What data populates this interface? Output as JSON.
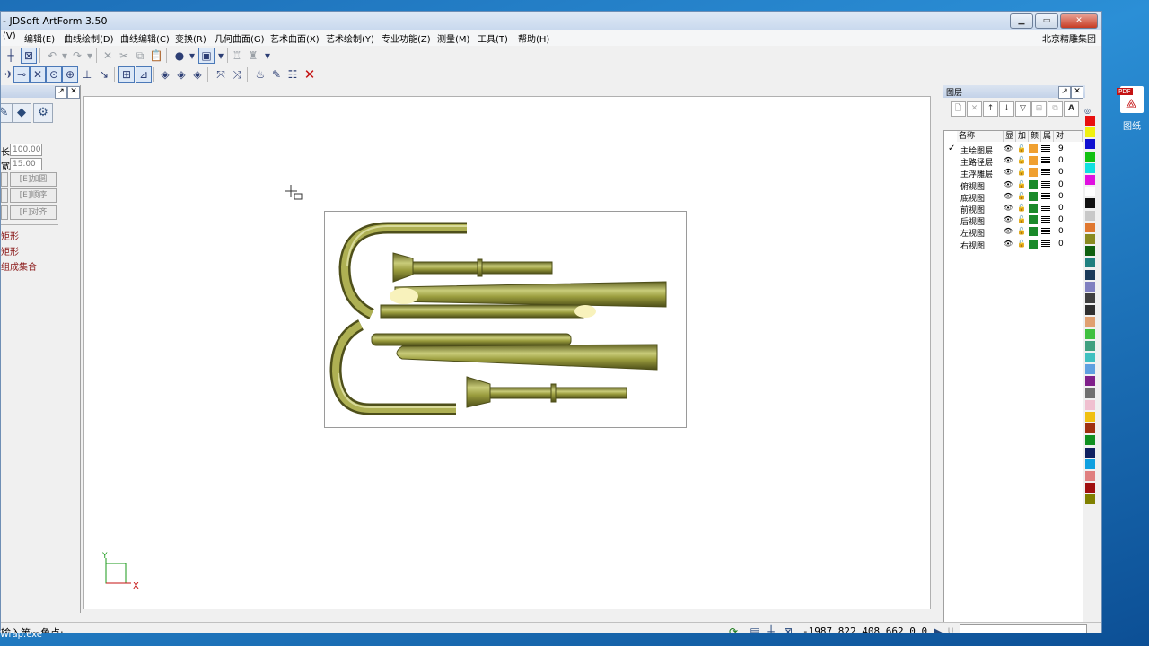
{
  "window": {
    "title": "- JDSoft ArtForm 3.50",
    "company": "北京精雕集团"
  },
  "menu": [
    "(V)",
    "编辑(E)",
    "曲线绘制(D)",
    "曲线编辑(C)",
    "变换(R)",
    "几何曲面(G)",
    "艺术曲面(X)",
    "艺术绘制(Y)",
    "专业功能(Z)",
    "测量(M)",
    "工具(T)",
    "帮助(H)"
  ],
  "left_panel": {
    "field1_label": "长:",
    "field1_value": "100.00",
    "field2_label": "宽:",
    "field2_value": "15.00",
    "btn1": "[E]加圆",
    "btn2": "[E]顺序",
    "btn3": "[E]对齐",
    "items": [
      "矩形",
      "矩形",
      "组成集合"
    ]
  },
  "layers": {
    "title": "图层",
    "headers": [
      "名称",
      "显",
      "加",
      "颜",
      "属",
      "对"
    ],
    "rows": [
      {
        "name": "主绘图层",
        "color": "#f0a030",
        "count": "9",
        "current": true
      },
      {
        "name": "主路径层",
        "color": "#f0a030",
        "count": "0",
        "current": false
      },
      {
        "name": "主浮雕层",
        "color": "#f0a030",
        "count": "0",
        "current": false
      },
      {
        "name": "俯视图",
        "color": "#1a8a2a",
        "count": "0",
        "current": false
      },
      {
        "name": "底视图",
        "color": "#1a8a2a",
        "count": "0",
        "current": false
      },
      {
        "name": "前视图",
        "color": "#1a8a2a",
        "count": "0",
        "current": false
      },
      {
        "name": "后视图",
        "color": "#1a8a2a",
        "count": "0",
        "current": false
      },
      {
        "name": "左视图",
        "color": "#1a8a2a",
        "count": "0",
        "current": false
      },
      {
        "name": "右视图",
        "color": "#1a8a2a",
        "count": "0",
        "current": false
      }
    ]
  },
  "palette": [
    "#e81010",
    "#f0f010",
    "#1010d0",
    "#10c010",
    "#10e0e0",
    "#e010e0",
    "#ffffff",
    "#101010",
    "#c8c8c8",
    "#e07830",
    "#8a8a20",
    "#106010",
    "#208080",
    "#1a3a5a",
    "#8080c0",
    "#404040",
    "#303030",
    "#e0a070",
    "#40c040",
    "#40a080",
    "#40c0c0",
    "#60a0e0",
    "#80208a",
    "#707070",
    "#f0c0d0",
    "#f0c010",
    "#a03010",
    "#109020",
    "#102060",
    "#10a0e0",
    "#e08080",
    "#a01010",
    "#808000"
  ],
  "axis": {
    "x": "X",
    "y": "Y"
  },
  "status": {
    "prompt": "输入第一角点:",
    "coords": "-1987.822 408.662 0.0"
  },
  "desktop": {
    "icon_label": "图纸",
    "pdf_badge": "PDF",
    "taskbar_text": "Wrap.exe"
  },
  "accent": "#8f9236"
}
